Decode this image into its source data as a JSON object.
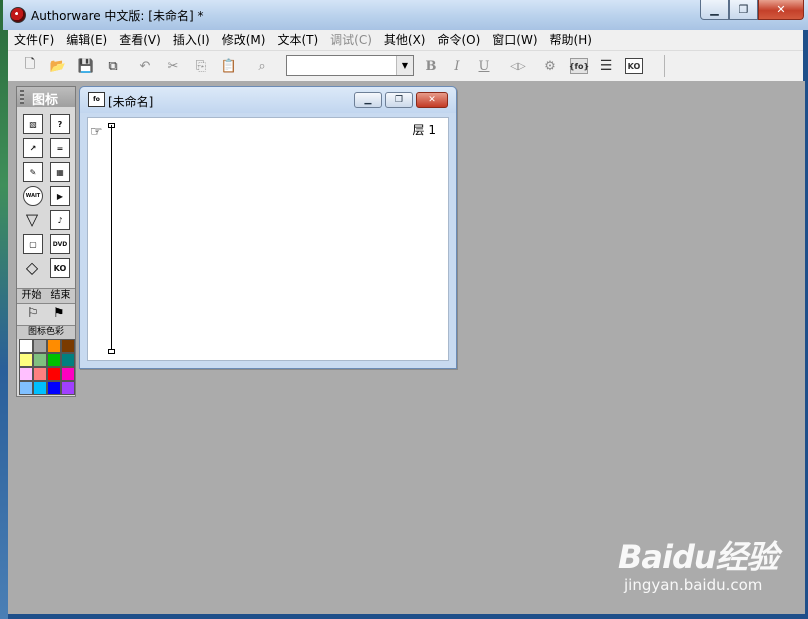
{
  "window": {
    "title": "Authorware 中文版: [未命名] *",
    "minimize": "▁",
    "restore": "❐",
    "close": "✕"
  },
  "menu": [
    {
      "label": "文件(F)",
      "enabled": true
    },
    {
      "label": "编辑(E)",
      "enabled": true
    },
    {
      "label": "查看(V)",
      "enabled": true
    },
    {
      "label": "插入(I)",
      "enabled": true
    },
    {
      "label": "修改(M)",
      "enabled": true
    },
    {
      "label": "文本(T)",
      "enabled": true
    },
    {
      "label": "调试(C)",
      "enabled": false
    },
    {
      "label": "其他(X)",
      "enabled": true
    },
    {
      "label": "命令(O)",
      "enabled": true
    },
    {
      "label": "窗口(W)",
      "enabled": true
    },
    {
      "label": "帮助(H)",
      "enabled": true
    }
  ],
  "toolbar": {
    "new": "🗋",
    "open": "📂",
    "save_all": "💾",
    "import": "⧉",
    "undo": "↶",
    "cut": "✂",
    "copy": "⎘",
    "paste": "📋",
    "find": "⌕",
    "font_value": "",
    "bold": "B",
    "italic": "I",
    "underline": "U",
    "restart": "◁▷",
    "control_panel": "⚙",
    "functions": "{fo}",
    "variables": "☰",
    "knowledge_objects": "KO"
  },
  "palette": {
    "title": "图标",
    "start_label": "开始",
    "end_label": "结束",
    "start_flag": "⚐",
    "end_flag": "⚑",
    "colors_label": "图标色彩",
    "icons": {
      "display": "▧",
      "motion": "?",
      "erase": "✎",
      "wait": "WAIT",
      "navigate": "↗",
      "framework": "▭",
      "decision": "◇",
      "interaction": "?",
      "calculation": "=",
      "map": "▦",
      "digital_movie": "▶",
      "sound": "♪",
      "video": "DVD",
      "knowledge_object": "KO",
      "frame": "▢"
    },
    "swatch_colors": [
      "#ffffff",
      "#a6a6a6",
      "#ff8c00",
      "#7a3a00",
      "#ffff80",
      "#80c080",
      "#00c000",
      "#008080",
      "#ffc0ff",
      "#ff8080",
      "#ff0000",
      "#ff00c0",
      "#80c0ff",
      "#00c0ff",
      "#0000ff",
      "#a040ff"
    ]
  },
  "document": {
    "title": "[未命名]",
    "icon": "fo",
    "minimize": "▁",
    "restore": "❐",
    "close": "✕",
    "layer_label": "层 1",
    "hand": "☞"
  },
  "watermark": {
    "main": "Baidu经验",
    "sub": "jingyan.baidu.com"
  }
}
